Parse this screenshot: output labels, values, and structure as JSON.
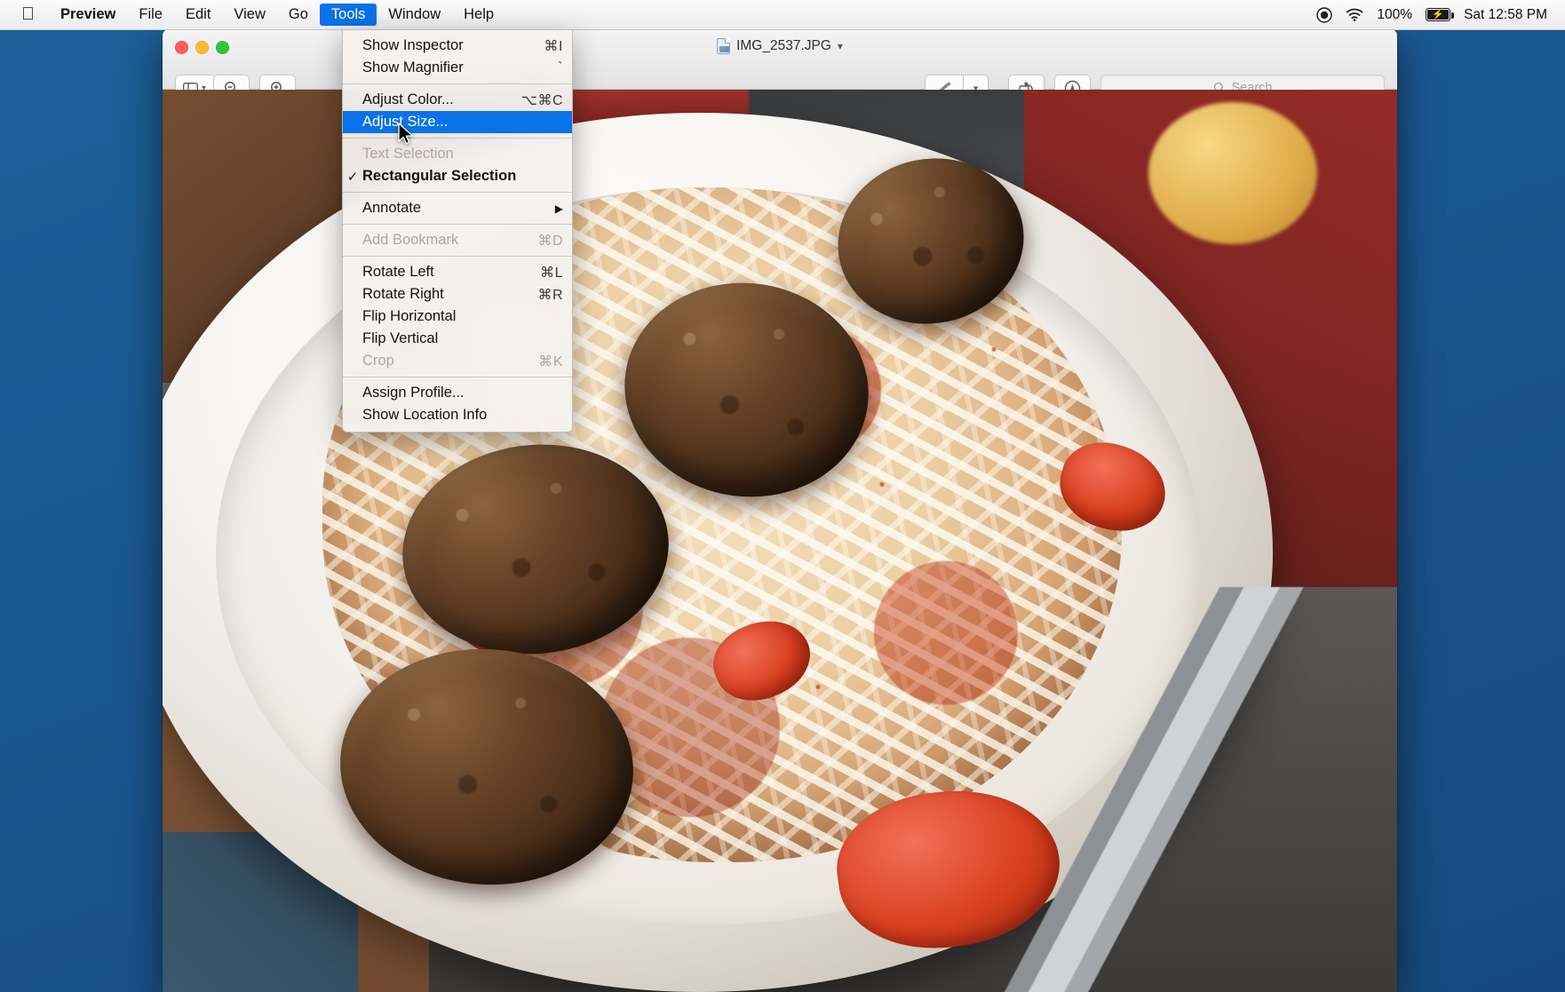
{
  "menubar": {
    "apple_icon": "apple-logo",
    "items": [
      {
        "label": "Preview",
        "bold": true,
        "active": false
      },
      {
        "label": "File",
        "bold": false,
        "active": false
      },
      {
        "label": "Edit",
        "bold": false,
        "active": false
      },
      {
        "label": "View",
        "bold": false,
        "active": false
      },
      {
        "label": "Go",
        "bold": false,
        "active": false
      },
      {
        "label": "Tools",
        "bold": false,
        "active": true
      },
      {
        "label": "Window",
        "bold": false,
        "active": false
      },
      {
        "label": "Help",
        "bold": false,
        "active": false
      }
    ],
    "status": {
      "screen_recording_icon": "record-icon",
      "wifi_icon": "wifi-icon",
      "battery_percent": "100%",
      "battery_icon": "battery-charging-icon",
      "clock": "Sat 12:58 PM"
    },
    "highlight_color": "#0a72e8"
  },
  "window": {
    "title": "IMG_2537.JPG",
    "title_icon": "jpeg-document-icon",
    "title_chevron": "chevron-down-icon",
    "traffic_lights": {
      "close": "close-button",
      "minimize": "minimize-button",
      "zoom": "zoom-button",
      "close_color": "#fc5f57",
      "minimize_color": "#fdbc2d",
      "zoom_color": "#29c83f"
    },
    "toolbar": {
      "sidebar_label": "sidebar-view",
      "sidebar_chevron": "chevron-down-icon",
      "zoom_out_label": "zoom-out",
      "zoom_in_label": "zoom-in",
      "markup_label": "markup",
      "markup_chevron": "chevron-down-icon",
      "rotate_label": "rotate",
      "annotate_label": "annotate"
    },
    "search": {
      "placeholder": "Search",
      "icon": "search-icon",
      "value": ""
    }
  },
  "tools_menu": {
    "open": true,
    "groups": [
      {
        "items": [
          {
            "label": "Show Inspector",
            "shortcut": "⌘I",
            "state": "normal",
            "checked": false,
            "submenu": false
          },
          {
            "label": "Show Magnifier",
            "shortcut": "`",
            "state": "normal",
            "checked": false,
            "submenu": false
          }
        ]
      },
      {
        "items": [
          {
            "label": "Adjust Color...",
            "shortcut": "⌥⌘C",
            "state": "normal",
            "checked": false,
            "submenu": false
          },
          {
            "label": "Adjust Size...",
            "shortcut": "",
            "state": "selected",
            "checked": false,
            "submenu": false
          }
        ]
      },
      {
        "items": [
          {
            "label": "Text Selection",
            "shortcut": "",
            "state": "disabled",
            "checked": false,
            "submenu": false
          },
          {
            "label": "Rectangular Selection",
            "shortcut": "",
            "state": "normal",
            "checked": true,
            "submenu": false
          }
        ]
      },
      {
        "items": [
          {
            "label": "Annotate",
            "shortcut": "",
            "state": "normal",
            "checked": false,
            "submenu": true
          }
        ]
      },
      {
        "items": [
          {
            "label": "Add Bookmark",
            "shortcut": "⌘D",
            "state": "disabled",
            "checked": false,
            "submenu": false
          }
        ]
      },
      {
        "items": [
          {
            "label": "Rotate Left",
            "shortcut": "⌘L",
            "state": "normal",
            "checked": false,
            "submenu": false
          },
          {
            "label": "Rotate Right",
            "shortcut": "⌘R",
            "state": "normal",
            "checked": false,
            "submenu": false
          },
          {
            "label": "Flip Horizontal",
            "shortcut": "",
            "state": "normal",
            "checked": false,
            "submenu": false
          },
          {
            "label": "Flip Vertical",
            "shortcut": "",
            "state": "normal",
            "checked": false,
            "submenu": false
          },
          {
            "label": "Crop",
            "shortcut": "⌘K",
            "state": "disabled",
            "checked": false,
            "submenu": false
          }
        ]
      },
      {
        "items": [
          {
            "label": "Assign Profile...",
            "shortcut": "",
            "state": "normal",
            "checked": false,
            "submenu": false
          },
          {
            "label": "Show Location Info",
            "shortcut": "",
            "state": "normal",
            "checked": false,
            "submenu": false
          }
        ]
      }
    ]
  },
  "content": {
    "description": "Photograph of spaghetti with meatballs, diced tomatoes and paprika in a white bowl with a fork",
    "cursor": "arrow-pointer"
  },
  "desktop": {
    "background_color": "#1b5a94"
  }
}
